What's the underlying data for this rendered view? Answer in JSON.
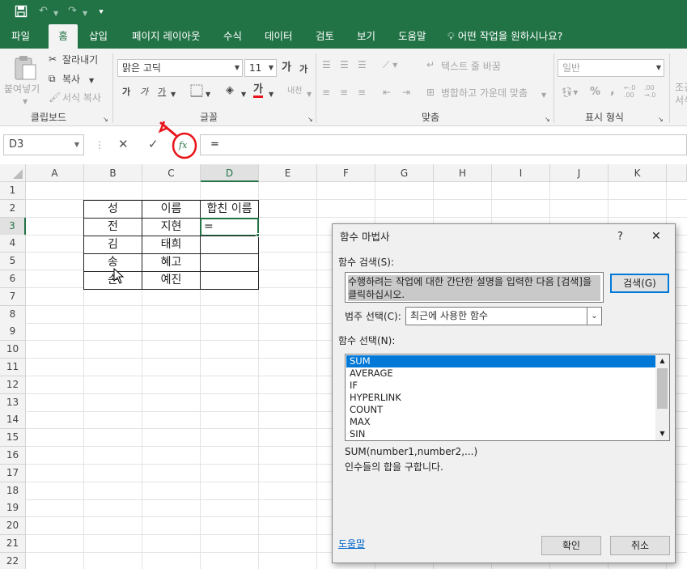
{
  "qat": {
    "save_icon": "save-icon",
    "undo_icon": "undo-icon",
    "redo_icon": "redo-icon",
    "customize_icon": "customize-qat-icon"
  },
  "tabs": [
    "파일",
    "홈",
    "삽입",
    "페이지 레이아웃",
    "수식",
    "데이터",
    "검토",
    "보기",
    "도움말"
  ],
  "tell_me": "어떤 작업을 원하시나요?",
  "ribbon": {
    "clipboard": {
      "paste": "붙여넣기",
      "cut": "잘라내기",
      "copy": "복사",
      "format_painter": "서식 복사",
      "label": "클립보드"
    },
    "font": {
      "name": "맑은 고딕",
      "size": "11",
      "grow": "가",
      "shrink": "가",
      "bold": "가",
      "italic": "가",
      "underline": "가",
      "font_color": "가",
      "phonetic": "내천",
      "label": "글꼴"
    },
    "alignment": {
      "wrap": "텍스트 줄 바꿈",
      "merge": "병합하고 가운데 맞춤",
      "label": "맞춤"
    },
    "number": {
      "format": "일반",
      "label": "표시 형식",
      "percent": "%",
      "comma": ","
    },
    "styles": {
      "conditional": "조건",
      "format": "서식"
    }
  },
  "formula_bar": {
    "name_box": "D3",
    "cancel": "✕",
    "enter": "✓",
    "fx": "fx",
    "value": "="
  },
  "grid": {
    "columns": [
      "A",
      "B",
      "C",
      "D",
      "E",
      "F",
      "G",
      "H",
      "I",
      "J",
      "K"
    ],
    "rows": [
      "1",
      "2",
      "3",
      "4",
      "5",
      "6",
      "7",
      "8",
      "9",
      "10",
      "11",
      "12",
      "13",
      "14",
      "15",
      "16",
      "17",
      "18",
      "19",
      "20",
      "21",
      "22"
    ],
    "selected_col": "D",
    "selected_row": "3",
    "table": {
      "headers": [
        "성",
        "이름",
        "합친 이름"
      ],
      "rows": [
        [
          "전",
          "지현",
          "="
        ],
        [
          "김",
          "태희",
          ""
        ],
        [
          "송",
          "혜고",
          ""
        ],
        [
          "손",
          "예진",
          ""
        ]
      ]
    }
  },
  "dialog": {
    "title": "함수 마법사",
    "help_glyph": "?",
    "close_glyph": "✕",
    "search_label": "함수 검색(S):",
    "search_text": "수행하려는 작업에 대한 간단한 설명을 입력한 다음 [검색]을 클릭하십시오.",
    "search_button": "검색(G)",
    "category_label": "범주 선택(C):",
    "category_value": "최근에 사용한 함수",
    "select_label": "함수 선택(N):",
    "functions": [
      "SUM",
      "AVERAGE",
      "IF",
      "HYPERLINK",
      "COUNT",
      "MAX",
      "SIN"
    ],
    "selected_function": "SUM",
    "syntax": "SUM(number1,number2,...)",
    "description": "인수들의 합을 구합니다.",
    "help_link": "도움말",
    "ok": "확인",
    "cancel": "취소"
  },
  "colors": {
    "excel_green": "#217346",
    "selection_blue": "#0078d7",
    "annotation_red": "#e8141a"
  }
}
